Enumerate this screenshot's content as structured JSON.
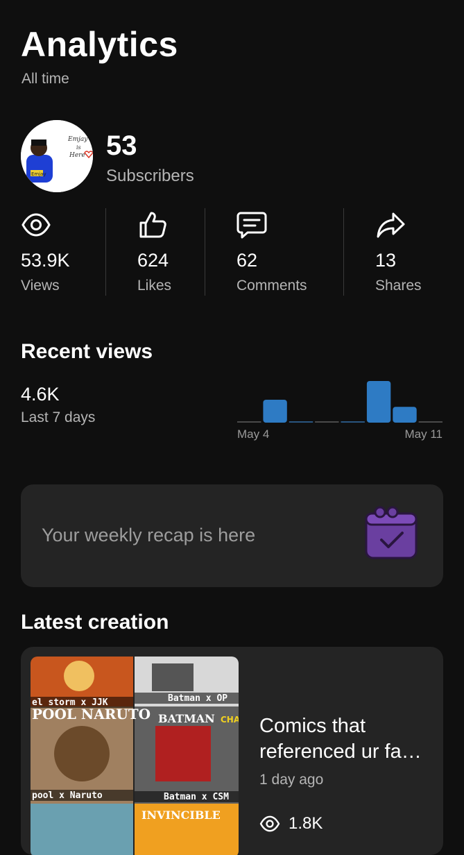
{
  "header": {
    "title": "Analytics",
    "subtitle": "All time"
  },
  "channel": {
    "subscribers_value": "53",
    "subscribers_label": "Subscribers",
    "avatar_text_1": "Emjay",
    "avatar_text_2": "is",
    "avatar_text_3": "Here"
  },
  "stats": [
    {
      "icon": "eye-icon",
      "value": "53.9K",
      "label": "Views"
    },
    {
      "icon": "thumbs-up-icon",
      "value": "624",
      "label": "Likes"
    },
    {
      "icon": "comment-icon",
      "value": "62",
      "label": "Comments"
    },
    {
      "icon": "share-arrow-icon",
      "value": "13",
      "label": "Shares"
    }
  ],
  "recent_views": {
    "title": "Recent views",
    "value": "4.6K",
    "label": "Last 7 days",
    "x_start_label": "May 4",
    "x_end_label": "May 11"
  },
  "chart_data": {
    "type": "bar",
    "categories": [
      "",
      "",
      "",
      "",
      "",
      "",
      "",
      ""
    ],
    "values": [
      0,
      0.55,
      0.02,
      0,
      0.02,
      1.0,
      0.38,
      0
    ],
    "xlabel": "",
    "ylabel": "",
    "x_tick_labels": [
      "May 4",
      "May 11"
    ],
    "grid": false,
    "bar_color": "#2e7bc4"
  },
  "recap": {
    "text": "Your weekly recap is here",
    "icon": "calendar-check-icon",
    "icon_color": "#6a3fa0"
  },
  "latest": {
    "section_title": "Latest creation",
    "title": "Comics that referenced ur fa…",
    "time": "1 day ago",
    "views": "1.8K",
    "thumb_captions": [
      "el storm x JJK",
      "Batman x OP",
      "POOL NARUTO",
      "BATMAN",
      "pool x Naruto",
      "Batman x CSM",
      "CHAINS",
      "INVINCIBLE"
    ]
  }
}
